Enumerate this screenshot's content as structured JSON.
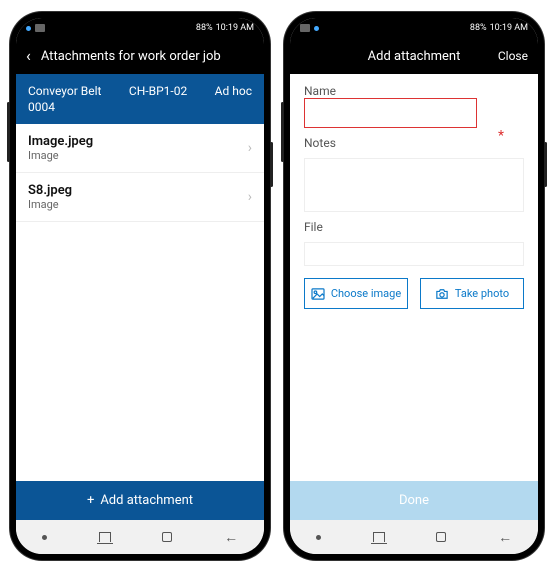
{
  "status": {
    "battery": "88%",
    "time": "10:19 AM"
  },
  "left": {
    "appbar_title": "Attachments for work order job",
    "sub_line1_a": "Conveyor Belt",
    "sub_line1_b": "CH-BP1-02",
    "sub_line1_c": "Ad hoc",
    "sub_line2": "0004",
    "items": [
      {
        "title": "Image.jpeg",
        "sub": "Image"
      },
      {
        "title": "S8.jpeg",
        "sub": "Image"
      }
    ],
    "bottom_label": "Add attachment"
  },
  "right": {
    "appbar_title": "Add attachment",
    "close_label": "Close",
    "name_label": "Name",
    "name_value": "",
    "required_mark": "*",
    "notes_label": "Notes",
    "notes_value": "",
    "file_label": "File",
    "choose_image": "Choose image",
    "take_photo": "Take photo",
    "done_label": "Done"
  }
}
